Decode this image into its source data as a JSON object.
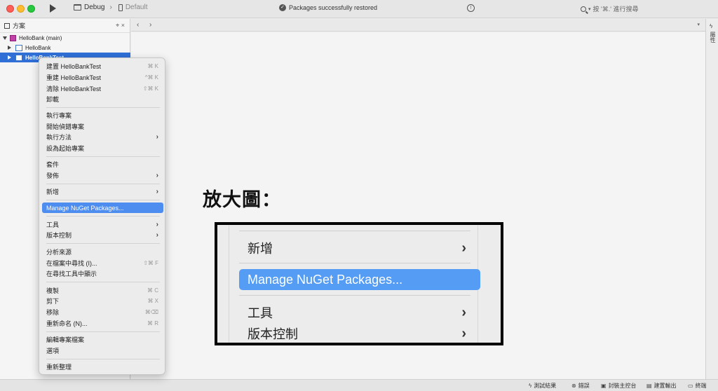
{
  "titlebar": {
    "config": "Debug",
    "device": "Default",
    "status": "Packages successfully restored",
    "search_placeholder": "按 '⌘.' 進行搜尋"
  },
  "pad": {
    "title": "方案",
    "items": [
      {
        "label": "HelloBank (main)"
      },
      {
        "label": "HelloBank"
      },
      {
        "label": "HelloBankTest"
      }
    ]
  },
  "menu": {
    "items": [
      {
        "label": "建置 HelloBankTest",
        "shortcut": "⌘ K"
      },
      {
        "label": "重建 HelloBankTest",
        "shortcut": "^⌘ K"
      },
      {
        "label": "清除 HelloBankTest",
        "shortcut": "⇧⌘ K"
      },
      {
        "label": "卸載",
        "shortcut": ""
      },
      {
        "label": "執行專案",
        "shortcut": ""
      },
      {
        "label": "開始偵錯專案",
        "shortcut": ""
      },
      {
        "label": "執行方法",
        "shortcut": ""
      },
      {
        "label": "設為起始專案",
        "shortcut": ""
      },
      {
        "label": "套件",
        "shortcut": ""
      },
      {
        "label": "發佈",
        "shortcut": ""
      },
      {
        "label": "新增",
        "shortcut": ""
      },
      {
        "label": "Manage NuGet Packages...",
        "shortcut": ""
      },
      {
        "label": "工具",
        "shortcut": ""
      },
      {
        "label": "版本控制",
        "shortcut": ""
      },
      {
        "label": "分析來源",
        "shortcut": ""
      },
      {
        "label": "在檔案中尋找 (I)...",
        "shortcut": "⇧⌘ F"
      },
      {
        "label": "在尋找工具中顯示",
        "shortcut": ""
      },
      {
        "label": "複製",
        "shortcut": "⌘ C"
      },
      {
        "label": "剪下",
        "shortcut": "⌘ X"
      },
      {
        "label": "移除",
        "shortcut": "⌘⌫"
      },
      {
        "label": "重新命名 (N)...",
        "shortcut": "⌘ R"
      },
      {
        "label": "編輯專案檔案",
        "shortcut": ""
      },
      {
        "label": "選項",
        "shortcut": ""
      },
      {
        "label": "重新整理",
        "shortcut": ""
      }
    ]
  },
  "zoom": {
    "title": "放大圖：",
    "items": [
      {
        "label": "新增"
      },
      {
        "label": "Manage NuGet Packages..."
      },
      {
        "label": "工具"
      },
      {
        "label": "版本控制"
      }
    ]
  },
  "right_strip": {
    "label": "屬性"
  },
  "bottombar": {
    "test_results": "測試結果",
    "errors": "錯誤",
    "package_console": "封裝主控台",
    "build_output": "建置輸出",
    "terminal": "終端"
  }
}
